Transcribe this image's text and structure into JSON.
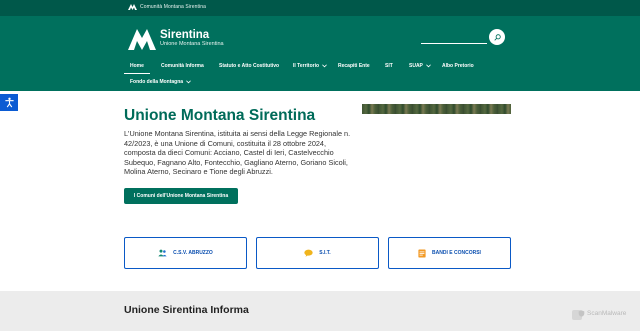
{
  "topbar": {
    "parent_label": "Comunità Montana Sirentina"
  },
  "header": {
    "title": "Sirentina",
    "subtitle": "Unione Montana Sirentina",
    "search_placeholder": ""
  },
  "nav": {
    "items": [
      {
        "label": "Home",
        "active": true,
        "dropdown": false
      },
      {
        "label": "Comunità Informa",
        "active": false,
        "dropdown": false
      },
      {
        "label": "Statuto e Atto Costitutivo",
        "active": false,
        "dropdown": false
      },
      {
        "label": "Il Territorio",
        "active": false,
        "dropdown": true
      },
      {
        "label": "Recapiti Ente",
        "active": false,
        "dropdown": false
      },
      {
        "label": "SIT",
        "active": false,
        "dropdown": false
      },
      {
        "label": "SUAP",
        "active": false,
        "dropdown": true
      },
      {
        "label": "Albo Pretorio",
        "active": false,
        "dropdown": false
      },
      {
        "label": "Fondo della Montagna",
        "active": false,
        "dropdown": true
      }
    ]
  },
  "hero": {
    "title": "Unione Montana Sirentina",
    "text": "L'Unione Montana Sirentina, istituita ai sensi della Legge Regionale n. 42/2023, è una Unione di Comuni, costituita il 28 ottobre 2024, composta da dieci Comuni: Acciano, Castel di Ieri, Castelvecchio Subequo, Fagnano Alto, Fontecchio, Gagliano Aterno, Goriano Sicoli, Molina Aterno, Secinaro e Tione degli Abruzzi.",
    "cta_label": "I Comuni dell'Unione Montana Sirentina"
  },
  "cards": [
    {
      "label": "C.S.V. ABRUZZO",
      "icon": "people-icon"
    },
    {
      "label": "S.I.T.",
      "icon": "chat-icon"
    },
    {
      "label": "BANDI E CONCORSI",
      "icon": "document-icon"
    }
  ],
  "informa": {
    "title": "Unione Sirentina Informa"
  },
  "watermark": {
    "label": "ScanMalware"
  },
  "colors": {
    "primary": "#00705d",
    "topbar": "#00584a",
    "accent_blue": "#0b4fb0",
    "accessibility": "#0b5bd3"
  }
}
